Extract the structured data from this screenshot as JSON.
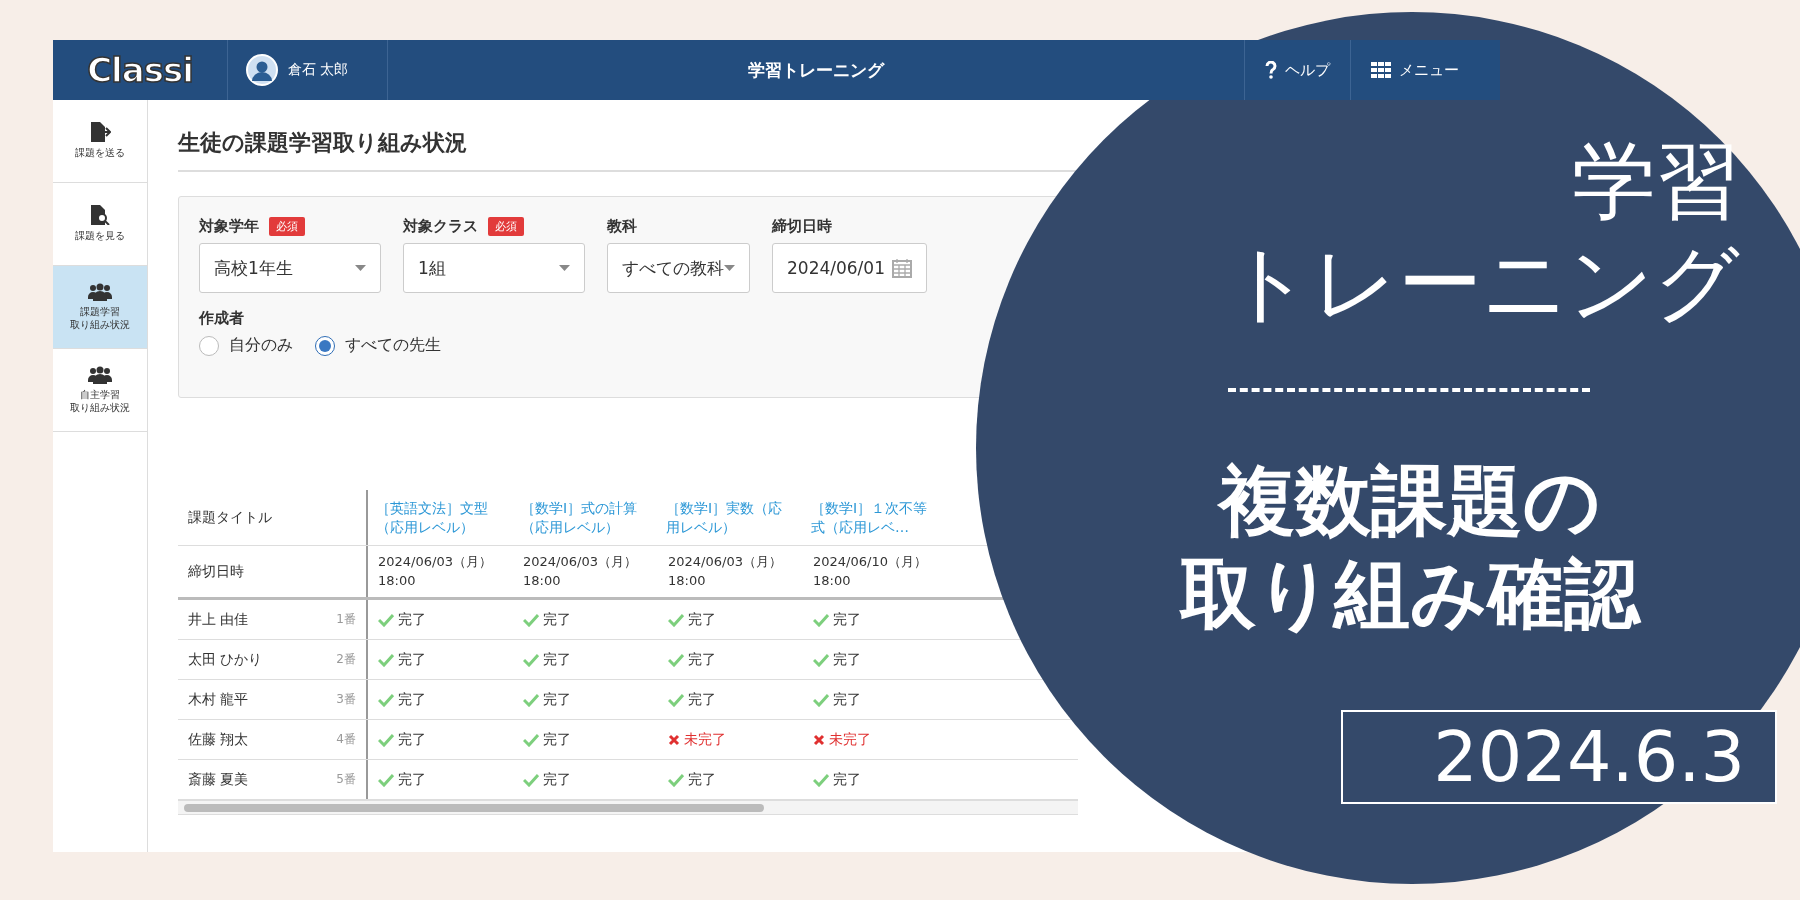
{
  "header": {
    "logo": "Classi",
    "user": "倉石 太郎",
    "title": "学習トレーニング",
    "help": "ヘルプ",
    "menu": "メニュー"
  },
  "sidebar": {
    "items": [
      {
        "label_lines": [
          "課題を送る"
        ],
        "kind": "send",
        "selected": false
      },
      {
        "label_lines": [
          "課題を見る"
        ],
        "kind": "view",
        "selected": false
      },
      {
        "label_lines": [
          "課題学習",
          "取り組み状況"
        ],
        "kind": "group",
        "selected": true
      },
      {
        "label_lines": [
          "自主学習",
          "取り組み状況"
        ],
        "kind": "group",
        "selected": false
      }
    ]
  },
  "page_title": "生徒の課題学習取り組み状況",
  "filters": {
    "fields": [
      {
        "label": "対象学年",
        "badge": "必須",
        "value": "高校1年生",
        "kind": "select"
      },
      {
        "label": "対象クラス",
        "badge": "必須",
        "value": "1組",
        "kind": "select"
      },
      {
        "label": "教科",
        "value": "すべての教科",
        "kind": "select"
      },
      {
        "label": "締切日時",
        "value": "2024/06/01",
        "kind": "date"
      }
    ],
    "author": {
      "label": "作成者",
      "options": [
        {
          "label": "自分のみ",
          "selected": false
        },
        {
          "label": "すべての先生",
          "selected": true
        }
      ]
    }
  },
  "table": {
    "title_label": "課題タイトル",
    "deadline_label": "締切日時",
    "columns": [
      {
        "title": "［英語文法］文型（応用レベル）",
        "deadline": "2024/06/03（月）\n18:00"
      },
      {
        "title": "［数学Ⅰ］式の計算（応用レベル）",
        "deadline": "2024/06/03（月）\n18:00"
      },
      {
        "title": "［数学Ⅰ］実数（応用レベル）",
        "deadline": "2024/06/03（月）\n18:00"
      },
      {
        "title": "［数学Ⅰ］１次不等式（応用レベ…",
        "deadline": "2024/06/10（月）\n18:00"
      }
    ],
    "rows": [
      {
        "name": "井上 由佳",
        "number": "1番",
        "cells": [
          {
            "kind": "done",
            "text": "完了"
          },
          {
            "kind": "done",
            "text": "完了"
          },
          {
            "kind": "done",
            "text": "完了"
          },
          {
            "kind": "done",
            "text": "完了"
          }
        ]
      },
      {
        "name": "太田 ひかり",
        "number": "2番",
        "cells": [
          {
            "kind": "done",
            "text": "完了"
          },
          {
            "kind": "done",
            "text": "完了"
          },
          {
            "kind": "done",
            "text": "完了"
          },
          {
            "kind": "done",
            "text": "完了"
          }
        ]
      },
      {
        "name": "木村 龍平",
        "number": "3番",
        "cells": [
          {
            "kind": "done",
            "text": "完了"
          },
          {
            "kind": "done",
            "text": "完了"
          },
          {
            "kind": "done",
            "text": "完了"
          },
          {
            "kind": "done",
            "text": "完了"
          }
        ]
      },
      {
        "name": "佐藤 翔太",
        "number": "4番",
        "cells": [
          {
            "kind": "done",
            "text": "完了"
          },
          {
            "kind": "done",
            "text": "完了"
          },
          {
            "kind": "undone",
            "text": "未完了"
          },
          {
            "kind": "undone",
            "text": "未完了"
          }
        ]
      },
      {
        "name": "斎藤 夏美",
        "number": "5番",
        "cells": [
          {
            "kind": "done",
            "text": "完了"
          },
          {
            "kind": "done",
            "text": "完了"
          },
          {
            "kind": "done",
            "text": "完了"
          },
          {
            "kind": "done",
            "text": "完了"
          }
        ]
      }
    ]
  },
  "overlay": {
    "title_lines": [
      "学習",
      "トレーニング"
    ],
    "subtitle_lines": [
      "複数課題の",
      "取り組み確認"
    ],
    "date": "2024.6.3"
  }
}
